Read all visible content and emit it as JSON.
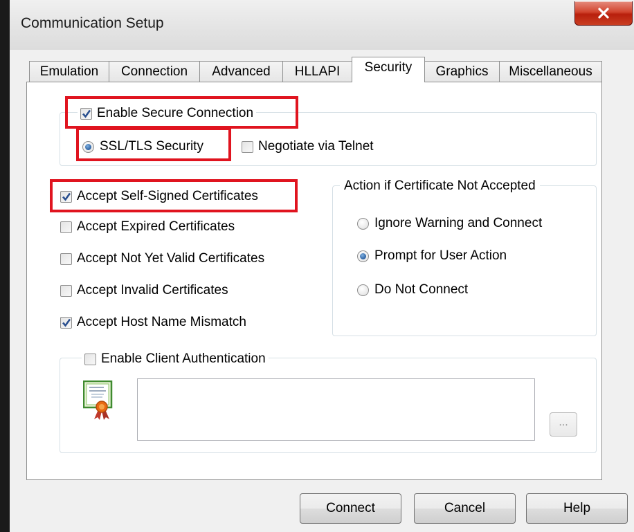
{
  "window": {
    "title": "Communication Setup",
    "close_label": "x"
  },
  "tabs": [
    {
      "label": "Emulation",
      "active": false
    },
    {
      "label": "Connection",
      "active": false
    },
    {
      "label": "Advanced",
      "active": false
    },
    {
      "label": "HLLAPI",
      "active": false
    },
    {
      "label": "Security",
      "active": true
    },
    {
      "label": "Graphics",
      "active": false
    },
    {
      "label": "Miscellaneous",
      "active": false
    }
  ],
  "secure_connection": {
    "enable_label": "Enable Secure Connection",
    "enable_checked": true,
    "ssl_label": "SSL/TLS Security",
    "ssl_selected": true,
    "telnet_label": "Negotiate via Telnet",
    "telnet_checked": false
  },
  "certificates": [
    {
      "label": "Accept Self-Signed Certificates",
      "checked": true
    },
    {
      "label": "Accept Expired Certificates",
      "checked": false
    },
    {
      "label": "Accept Not Yet Valid Certificates",
      "checked": false
    },
    {
      "label": "Accept Invalid Certificates",
      "checked": false
    },
    {
      "label": "Accept Host Name Mismatch",
      "checked": true
    }
  ],
  "action_group": {
    "title": "Action if Certificate Not Accepted",
    "options": [
      {
        "label": "Ignore Warning and Connect",
        "selected": false
      },
      {
        "label": "Prompt for User Action",
        "selected": true
      },
      {
        "label": "Do Not Connect",
        "selected": false
      }
    ]
  },
  "client_auth": {
    "enable_label": "Enable Client Authentication",
    "enable_checked": false,
    "certificate_value": "",
    "browse_label": "..."
  },
  "buttons": {
    "connect": "Connect",
    "cancel": "Cancel",
    "help": "Help"
  },
  "colors": {
    "highlight": "#e0141f",
    "window_bg": "#f0f0f0",
    "panel_bg": "#ffffff",
    "check_mark": "#2a4f8f"
  },
  "icons": {
    "certificate": "certificate-icon",
    "check": "checkmark-icon",
    "close": "close-x-icon"
  }
}
